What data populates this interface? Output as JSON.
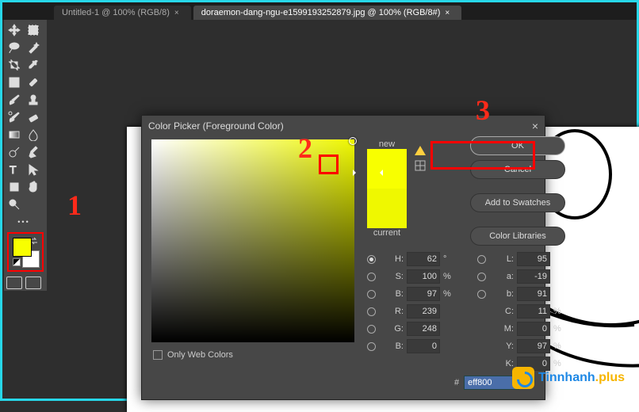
{
  "tabs": [
    {
      "label": "Untitled-1 @ 100% (RGB/8)",
      "active": false
    },
    {
      "label": "doraemon-dang-ngu-e1599193252879.jpg @ 100% (RGB/8#)",
      "active": true
    }
  ],
  "dialog": {
    "title": "Color Picker (Foreground Color)",
    "new_label": "new",
    "current_label": "current",
    "buttons": {
      "ok": "OK",
      "cancel": "Cancel",
      "add_swatch": "Add to Swatches",
      "libraries": "Color Libraries"
    },
    "fields": {
      "h": {
        "label": "H:",
        "value": "62",
        "unit": "°"
      },
      "s": {
        "label": "S:",
        "value": "100",
        "unit": "%"
      },
      "br": {
        "label": "B:",
        "value": "97",
        "unit": "%"
      },
      "r": {
        "label": "R:",
        "value": "239",
        "unit": ""
      },
      "g": {
        "label": "G:",
        "value": "248",
        "unit": ""
      },
      "b": {
        "label": "B:",
        "value": "0",
        "unit": ""
      },
      "L": {
        "label": "L:",
        "value": "95",
        "unit": ""
      },
      "a": {
        "label": "a:",
        "value": "-19",
        "unit": ""
      },
      "lb": {
        "label": "b:",
        "value": "91",
        "unit": ""
      },
      "c": {
        "label": "C:",
        "value": "11",
        "unit": "%"
      },
      "m": {
        "label": "M:",
        "value": "0",
        "unit": "%"
      },
      "y": {
        "label": "Y:",
        "value": "97",
        "unit": "%"
      },
      "k": {
        "label": "K:",
        "value": "0",
        "unit": "%"
      }
    },
    "hex_label": "#",
    "hex_value": "eff800",
    "only_web": "Only Web Colors"
  },
  "annotations": {
    "1": "1",
    "2": "2",
    "3": "3"
  },
  "watermark": {
    "t1": "Tin",
    "t2": "nhanh",
    "t3": ".plus"
  }
}
